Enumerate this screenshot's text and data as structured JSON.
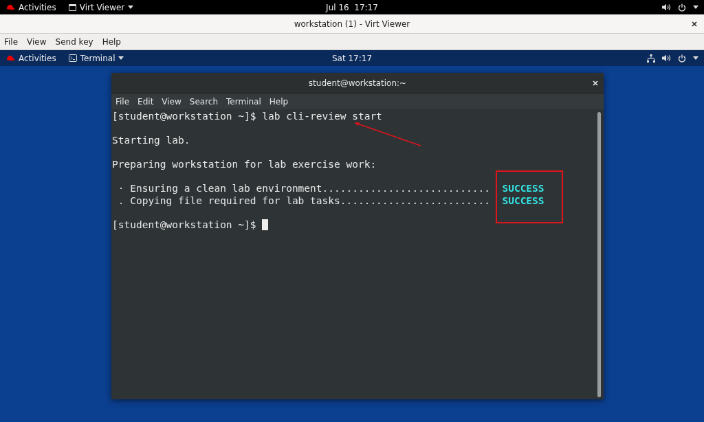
{
  "host_bar": {
    "activities": "Activities",
    "app": "Virt Viewer",
    "clock": "Jul 16  17:17"
  },
  "viewer_window": {
    "title": "workstation (1) - Virt Viewer",
    "menu": [
      "File",
      "View",
      "Send key",
      "Help"
    ]
  },
  "guest_bar": {
    "activities": "Activities",
    "app": "Terminal",
    "clock": "Sat 17:17"
  },
  "terminal": {
    "title": "student@workstation:~",
    "menu": [
      "File",
      "Edit",
      "View",
      "Search",
      "Terminal",
      "Help"
    ],
    "lines": [
      {
        "kind": "text",
        "text": "[student@workstation ~]$ lab cli-review start"
      },
      {
        "kind": "blank"
      },
      {
        "kind": "text",
        "text": "Starting lab."
      },
      {
        "kind": "blank"
      },
      {
        "kind": "text",
        "text": "Preparing workstation for lab exercise work:"
      },
      {
        "kind": "blank"
      },
      {
        "kind": "status",
        "text": " · Ensuring a clean lab environment............................",
        "status": "SUCCESS"
      },
      {
        "kind": "status",
        "text": " . Copying file required for lab tasks.........................",
        "status": "SUCCESS"
      },
      {
        "kind": "blank"
      },
      {
        "kind": "prompt",
        "text": "[student@workstation ~]$ ",
        "cursor": true
      }
    ]
  }
}
